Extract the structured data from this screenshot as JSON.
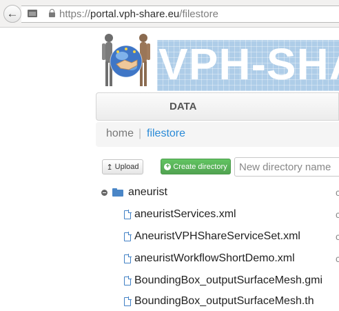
{
  "browser": {
    "url_prefix": "https://",
    "url_domain": "portal.vph-share.eu",
    "url_path": "/filestore"
  },
  "banner": {
    "title": "VPH-SHARE",
    "accent": "#aecde8"
  },
  "nav": {
    "tabs": [
      {
        "label": "DATA"
      }
    ]
  },
  "breadcrumb": {
    "home": "home",
    "separator": "|",
    "current": "filestore"
  },
  "toolbar": {
    "upload_label": "Upload",
    "create_label": "Create directory",
    "new_dir_placeholder": "New directory name"
  },
  "tree": {
    "root": {
      "name": "aneurist",
      "icon": "folder-open-icon",
      "expanded": true
    },
    "files": [
      {
        "name": "aneuristServices.xml",
        "icon": "file-icon"
      },
      {
        "name": "AneuristVPHShareServiceSet.xml",
        "icon": "file-icon"
      },
      {
        "name": "aneuristWorkflowShortDemo.xml",
        "icon": "file-icon"
      },
      {
        "name": "BoundingBox_outputSurfaceMesh.gmi",
        "icon": "file-icon"
      },
      {
        "name": "BoundingBox_outputSurfaceMesh.th",
        "icon": "file-icon"
      }
    ],
    "side_marker": "c"
  },
  "colors": {
    "link": "#2a8ad7",
    "create_button": "#51a351",
    "icon_blue": "#3f7fc4"
  }
}
